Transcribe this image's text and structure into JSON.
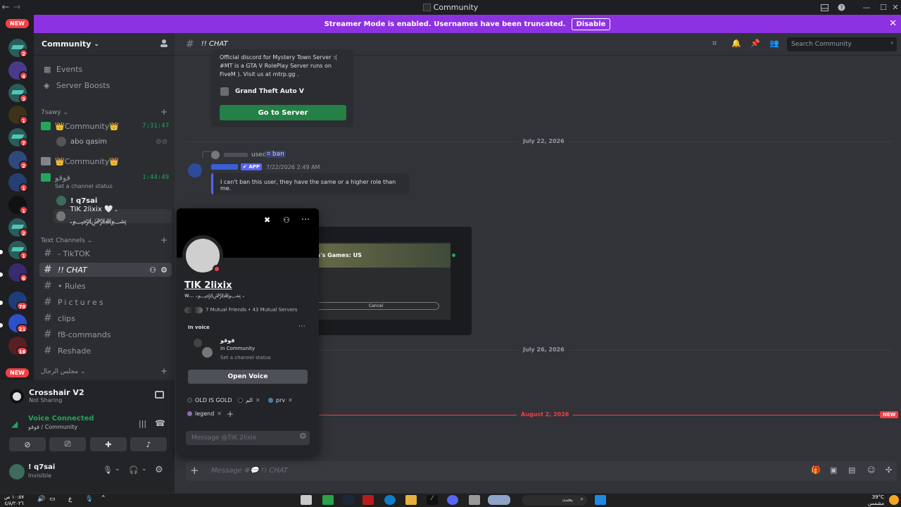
{
  "titlebar": {
    "title": "Community"
  },
  "banner": {
    "text": "Streamer Mode is enabled. Usernames have been truncated.",
    "button": "Disable"
  },
  "rail": {
    "new_top": "NEW",
    "new_bottom": "NEW",
    "badges": [
      "2",
      "4",
      "3",
      "1",
      "7",
      "2",
      "1",
      "1",
      "2",
      "1",
      "6",
      "78",
      "21",
      "16"
    ]
  },
  "server": {
    "name": "Community"
  },
  "sidebar": {
    "events": "Events",
    "boosts": "Server Boosts",
    "cat1": "7sawy",
    "vc1": {
      "name": "👑Community👑",
      "time": "7:31:47"
    },
    "vc1_user": "abo qasim",
    "vc2": {
      "name": "👑Community👑"
    },
    "vc3": {
      "name": "قوقو",
      "time": "1:44:49",
      "status": "Set a channel status"
    },
    "vc3_users": [
      "! q7sai",
      "TIK 2lixix 🤍 ۦ ﷽ۦ"
    ],
    "cat2": "Text Channels",
    "channels": [
      "- TikTOK",
      "!! CHAT",
      "• Rules",
      "Pictures",
      "clips",
      "f8-commands",
      "Reshade"
    ],
    "cat3": "مجلس الرجال"
  },
  "panel": {
    "stream_title": "Crosshair V2",
    "stream_sub": "Not Sharing",
    "voice_title": "Voice Connected",
    "voice_sub": "قوقو / Community",
    "user_name": "! q7sai",
    "user_status": "Invisible"
  },
  "chat": {
    "channel": "!! CHAT",
    "search_placeholder": "Search Community",
    "embed_text": "Official discord for Mystery Town Server :( #MT is a GTA V RolePlay Server runs on FiveM ). Visit us at mtrp.gg .",
    "embed_game": "Grand Theft Auto V",
    "embed_button": "Go to Server",
    "date1": "July 22, 2026",
    "used": "used",
    "cmd": "ban",
    "app_badge": "APP",
    "timestamp": "7/22/2026 2:49 AM",
    "bot_reply": "I can't ban this user, they have the same or a higher role than me.",
    "date2": "July 26, 2026",
    "date3": "August 2, 2026",
    "new_label": "NEW",
    "input_placeholder": "Message #💬 !! CHAT",
    "image_title": "ga's Games: US",
    "image_cancel": "Cancel"
  },
  "popout": {
    "display_name": "TIK 2lixix",
    "username": "w... ۦ ﷽ۦ",
    "mutuals": "7 Mutual Friends • 43 Mutual Servers",
    "in_voice": "In voice",
    "voice_channel": "قوقو",
    "voice_server": "in Community",
    "voice_status": "Set a channel status",
    "open_voice": "Open Voice",
    "roles": [
      {
        "name": "OLD IS GOLD",
        "color": "#2b2d31"
      },
      {
        "name": "الم",
        "color": "#111111"
      },
      {
        "name": "prv",
        "color": "#4b7fa8"
      },
      {
        "name": "legend",
        "color": "#8e6fb0"
      }
    ],
    "dm_placeholder": "Message @TIK 2lixix"
  },
  "taskbar": {
    "time": "١٠:٥٧ ص",
    "date": "٤/٨/٢٠٢٦",
    "lang": "ع",
    "search": "بحث",
    "weather_temp": "39°C",
    "weather_text": "مشمس"
  },
  "colors": {
    "accent": "#8c32e0",
    "green": "#23a55a",
    "red": "#f23f43",
    "blurple": "#5865f2"
  }
}
